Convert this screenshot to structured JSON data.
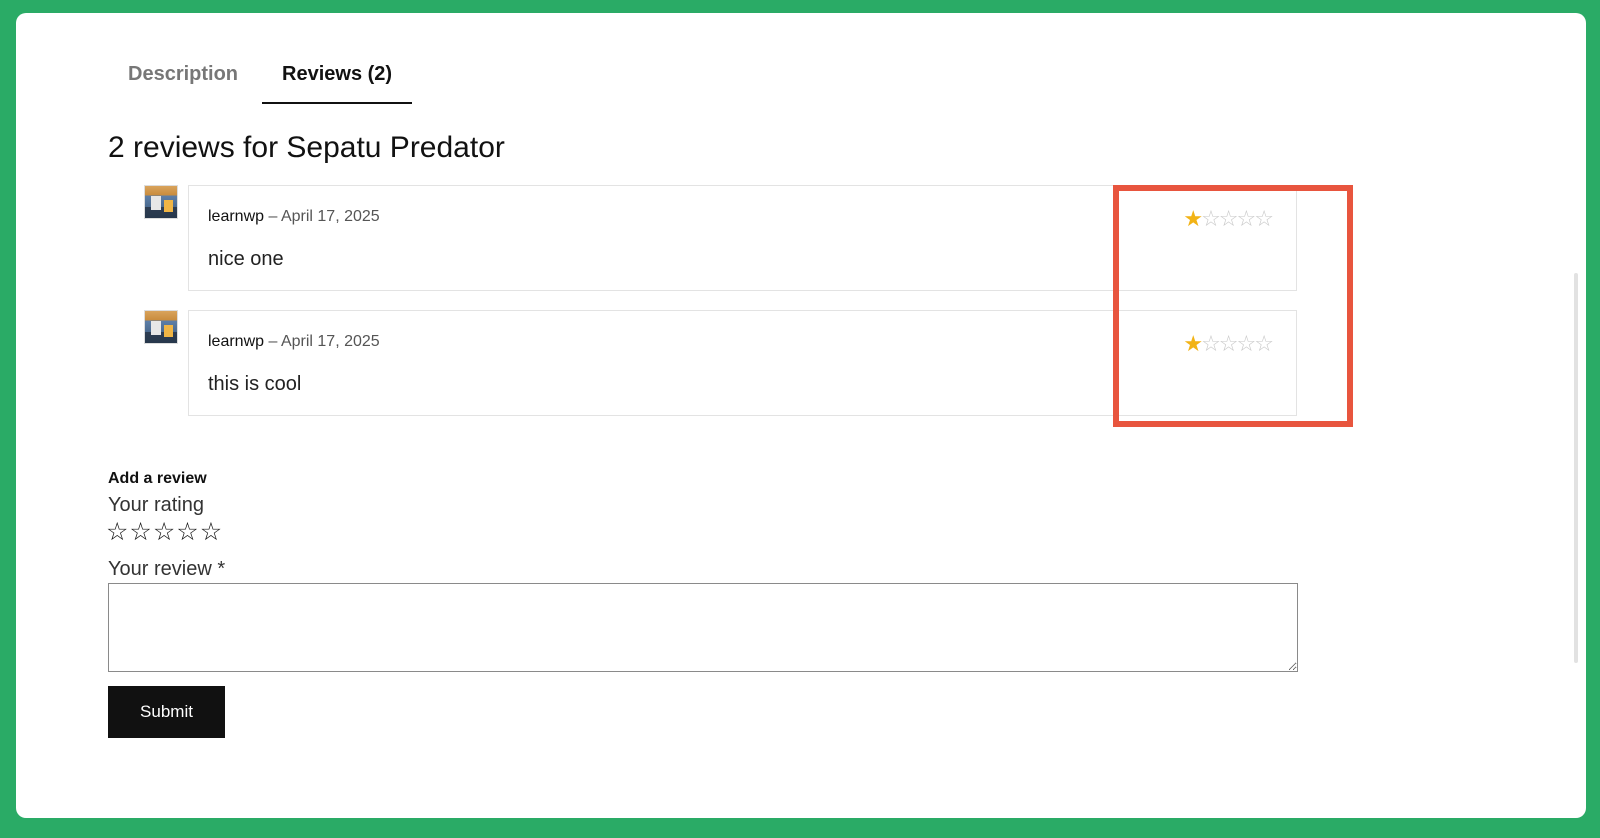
{
  "tabs": [
    {
      "label": "Description",
      "active": false
    },
    {
      "label": "Reviews (2)",
      "active": true
    }
  ],
  "heading": "2 reviews for Sepatu Predator",
  "reviews": [
    {
      "author": "learnwp",
      "separator": " – ",
      "date": "April 17, 2025",
      "comment": "nice one",
      "rating": 1,
      "max_rating": 5
    },
    {
      "author": "learnwp",
      "separator": " – ",
      "date": "April 17, 2025",
      "comment": "this is cool",
      "rating": 1,
      "max_rating": 5
    }
  ],
  "form": {
    "title": "Add a review",
    "rating_label": "Your rating",
    "rating_max": 5,
    "review_label": "Your review *",
    "review_value": "",
    "submit_label": "Submit"
  },
  "colors": {
    "background": "#2aab66",
    "highlight": "#e8553e",
    "star_filled": "#f2b316",
    "star_empty": "#c9c9c9",
    "button": "#111111"
  }
}
